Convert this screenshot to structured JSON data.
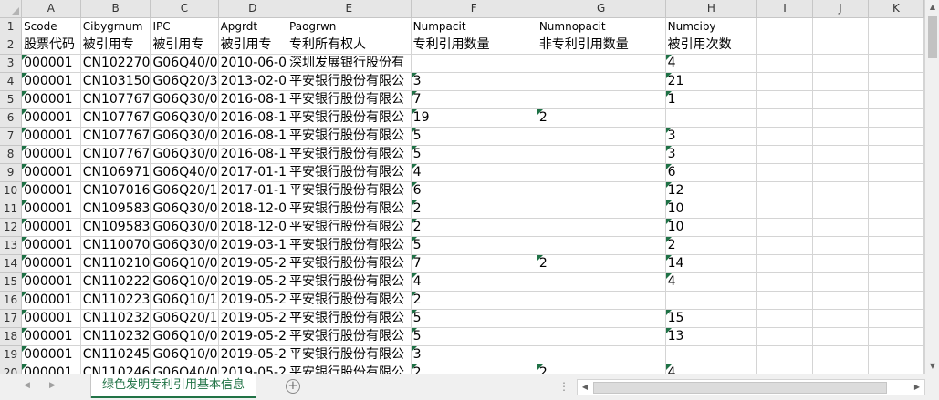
{
  "columns": [
    "A",
    "B",
    "C",
    "D",
    "E",
    "F",
    "G",
    "H",
    "I",
    "J",
    "K"
  ],
  "header_row": [
    "Scode",
    "Cibygrnum",
    "IPC",
    "Apgrdt",
    "Paogrwn",
    "Numpacit",
    "Numnopacit",
    "Numciby",
    "",
    "",
    ""
  ],
  "label_row": [
    "股票代码",
    "被引用专",
    "被引用专",
    "被引用专",
    "专利所有权人",
    "专利引用数量",
    "非专利引用数量",
    "被引用次数",
    "",
    "",
    ""
  ],
  "rows": [
    {
      "n": "3",
      "c": [
        "000001",
        "CN102270",
        "G06Q40/0",
        "2010-06-0",
        "深圳发展银行股份有",
        "",
        "",
        "4",
        "",
        "",
        ""
      ]
    },
    {
      "n": "4",
      "c": [
        "000001",
        "CN103150",
        "G06Q20/3",
        "2013-02-0",
        "平安银行股份有限公",
        "3",
        "",
        "21",
        "",
        "",
        ""
      ]
    },
    {
      "n": "5",
      "c": [
        "000001",
        "CN107767",
        "G06Q30/0",
        "2016-08-1",
        "平安银行股份有限公",
        "7",
        "",
        "1",
        "",
        "",
        ""
      ]
    },
    {
      "n": "6",
      "c": [
        "000001",
        "CN107767",
        "G06Q30/0",
        "2016-08-1",
        "平安银行股份有限公",
        "19",
        "2",
        "",
        "",
        "",
        ""
      ]
    },
    {
      "n": "7",
      "c": [
        "000001",
        "CN107767",
        "G06Q30/0",
        "2016-08-1",
        "平安银行股份有限公",
        "5",
        "",
        "3",
        "",
        "",
        ""
      ]
    },
    {
      "n": "8",
      "c": [
        "000001",
        "CN107767",
        "G06Q30/0",
        "2016-08-1",
        "平安银行股份有限公",
        "5",
        "",
        "3",
        "",
        "",
        ""
      ]
    },
    {
      "n": "9",
      "c": [
        "000001",
        "CN106971",
        "G06Q40/0",
        "2017-01-1",
        "平安银行股份有限公",
        "4",
        "",
        "6",
        "",
        "",
        ""
      ]
    },
    {
      "n": "10",
      "c": [
        "000001",
        "CN107016",
        "G06Q20/1",
        "2017-01-1",
        "平安银行股份有限公",
        "6",
        "",
        "12",
        "",
        "",
        ""
      ]
    },
    {
      "n": "11",
      "c": [
        "000001",
        "CN109583",
        "G06Q30/0",
        "2018-12-0",
        "平安银行股份有限公",
        "2",
        "",
        "10",
        "",
        "",
        ""
      ]
    },
    {
      "n": "12",
      "c": [
        "000001",
        "CN109583",
        "G06Q30/0",
        "2018-12-0",
        "平安银行股份有限公",
        "2",
        "",
        "10",
        "",
        "",
        ""
      ]
    },
    {
      "n": "13",
      "c": [
        "000001",
        "CN110070",
        "G06Q30/0",
        "2019-03-1",
        "平安银行股份有限公",
        "5",
        "",
        "2",
        "",
        "",
        ""
      ]
    },
    {
      "n": "14",
      "c": [
        "000001",
        "CN110210",
        "G06Q10/0",
        "2019-05-2",
        "平安银行股份有限公",
        "7",
        "2",
        "14",
        "",
        "",
        ""
      ]
    },
    {
      "n": "15",
      "c": [
        "000001",
        "CN110222",
        "G06Q10/0",
        "2019-05-2",
        "平安银行股份有限公",
        "4",
        "",
        "4",
        "",
        "",
        ""
      ]
    },
    {
      "n": "16",
      "c": [
        "000001",
        "CN110223",
        "G06Q10/1",
        "2019-05-2",
        "平安银行股份有限公",
        "2",
        "",
        "",
        "",
        "",
        ""
      ]
    },
    {
      "n": "17",
      "c": [
        "000001",
        "CN110232",
        "G06Q20/1",
        "2019-05-2",
        "平安银行股份有限公",
        "5",
        "",
        "15",
        "",
        "",
        ""
      ]
    },
    {
      "n": "18",
      "c": [
        "000001",
        "CN110232",
        "G06Q10/0",
        "2019-05-2",
        "平安银行股份有限公",
        "5",
        "",
        "13",
        "",
        "",
        ""
      ]
    },
    {
      "n": "19",
      "c": [
        "000001",
        "CN110245",
        "G06Q10/0",
        "2019-05-2",
        "平安银行股份有限公",
        "3",
        "",
        "",
        "",
        "",
        ""
      ]
    },
    {
      "n": "20",
      "c": [
        "000001",
        "CN110246",
        "G06Q40/0",
        "2019-05-2",
        "平安银行股份有限公",
        "2",
        "2",
        "4",
        "",
        "",
        ""
      ]
    }
  ],
  "sheet_tab": "绿色发明专利引用基本信息",
  "icons": {
    "add_sheet": "plus-circle-icon",
    "nav_prev": "triangle-left-icon",
    "nav_next": "triangle-right-icon",
    "more": "ellipsis-icon"
  },
  "accent_color": "#217346"
}
